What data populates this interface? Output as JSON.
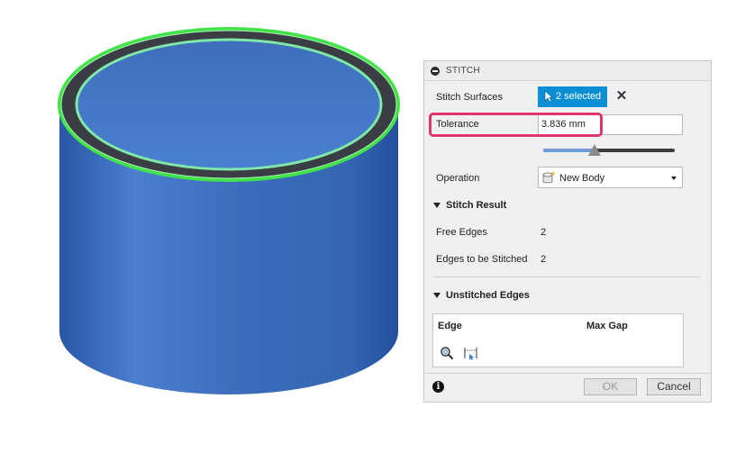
{
  "panel": {
    "title": "STITCH",
    "stitch_surfaces": {
      "label": "Stitch Surfaces",
      "button_label": "2 selected"
    },
    "tolerance": {
      "label": "Tolerance",
      "value": "3.836 mm",
      "slider_fraction": 0.39
    },
    "operation": {
      "label": "Operation",
      "selected": "New Body"
    },
    "stitch_result": {
      "heading": "Stitch Result",
      "free_edges_label": "Free Edges",
      "free_edges_value": "2",
      "edges_stitched_label": "Edges to be Stitched",
      "edges_stitched_value": "2"
    },
    "unstitched_edges": {
      "heading": "Unstitched Edges",
      "columns": [
        "Edge",
        "Max Gap"
      ]
    },
    "buttons": {
      "ok": "OK",
      "cancel": "Cancel"
    }
  },
  "colors": {
    "accent": "#0a8fd6",
    "highlight": "#e0346a",
    "model_blue": "#3a6fc0",
    "edge_green": "#42e24a"
  }
}
